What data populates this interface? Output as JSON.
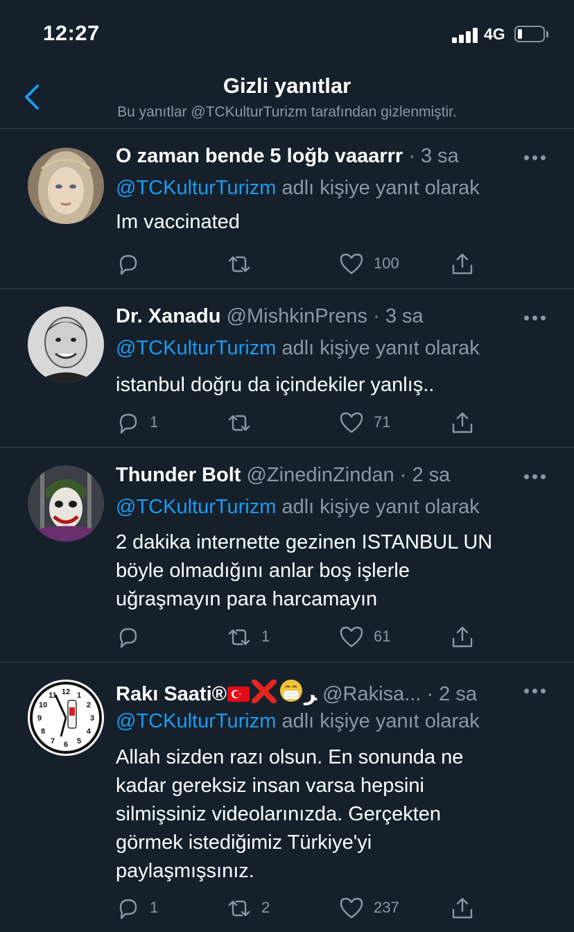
{
  "status_bar": {
    "time": "12:27",
    "network": "4G"
  },
  "header": {
    "title": "Gizli yanıtlar",
    "subtitle": "Bu yanıtlar @TCKulturTurizm tarafından gizlenmiştir."
  },
  "colors": {
    "background": "#15202b",
    "accent": "#1d9bf0",
    "secondary_text": "#8b98a5",
    "divider": "#38444d"
  },
  "replies": [
    {
      "name": "O zaman bende 5 loğb vaaarrr",
      "handle": "",
      "time": "3 sa",
      "reply_to_mention": "@TCKulturTurizm",
      "reply_to_suffix": "adlı kişiye yanıt olarak",
      "text": "Im vaccinated",
      "replies_count": "",
      "retweets_count": "",
      "likes_count": "100",
      "avatar": "avatar-elf-woman"
    },
    {
      "name": "Dr. Xanadu",
      "handle": "@MishkinPrens",
      "time": "3 sa",
      "reply_to_mention": "@TCKulturTurizm",
      "reply_to_suffix": "adlı kişiye yanıt olarak",
      "text": "istanbul doğru da içindekiler yanlış..",
      "replies_count": "1",
      "retweets_count": "",
      "likes_count": "71",
      "avatar": "avatar-bw-man"
    },
    {
      "name": "Thunder Bolt",
      "handle": "@ZinedinZindan",
      "time": "2 sa",
      "reply_to_mention": "@TCKulturTurizm",
      "reply_to_suffix": "adlı kişiye yanıt olarak",
      "text_lines": [
        "2 dakika internette gezinen ISTANBUL UN",
        "böyle olmadığını anlar boş işlerle",
        "uğraşmayın para harcamayın"
      ],
      "replies_count": "",
      "retweets_count": "1",
      "likes_count": "61",
      "avatar": "avatar-joker"
    },
    {
      "name": "Rakı Saati®",
      "name_emojis": [
        "turkey-flag-emoji",
        "cross-mark-emoji",
        "mask-face-emoji"
      ],
      "name_extra": "ﺮ",
      "handle": "@Rakisa...",
      "time": "2 sa",
      "reply_to_mention": "@TCKulturTurizm",
      "reply_to_suffix": "adlı kişiye yanıt olarak",
      "text_lines": [
        "Allah sizden razı olsun. En sonunda ne",
        "kadar gereksiz insan varsa hepsini",
        "silmişsiniz videolarınızda. Gerçekten",
        "görmek istediğimiz Türkiye'yi",
        "paylaşmışsınız."
      ],
      "replies_count": "1",
      "retweets_count": "2",
      "likes_count": "237",
      "avatar": "avatar-clock"
    }
  ],
  "clock_numbers": [
    "12",
    "1",
    "2",
    "3",
    "4",
    "5",
    "6",
    "7",
    "8",
    "9",
    "10",
    "11"
  ]
}
